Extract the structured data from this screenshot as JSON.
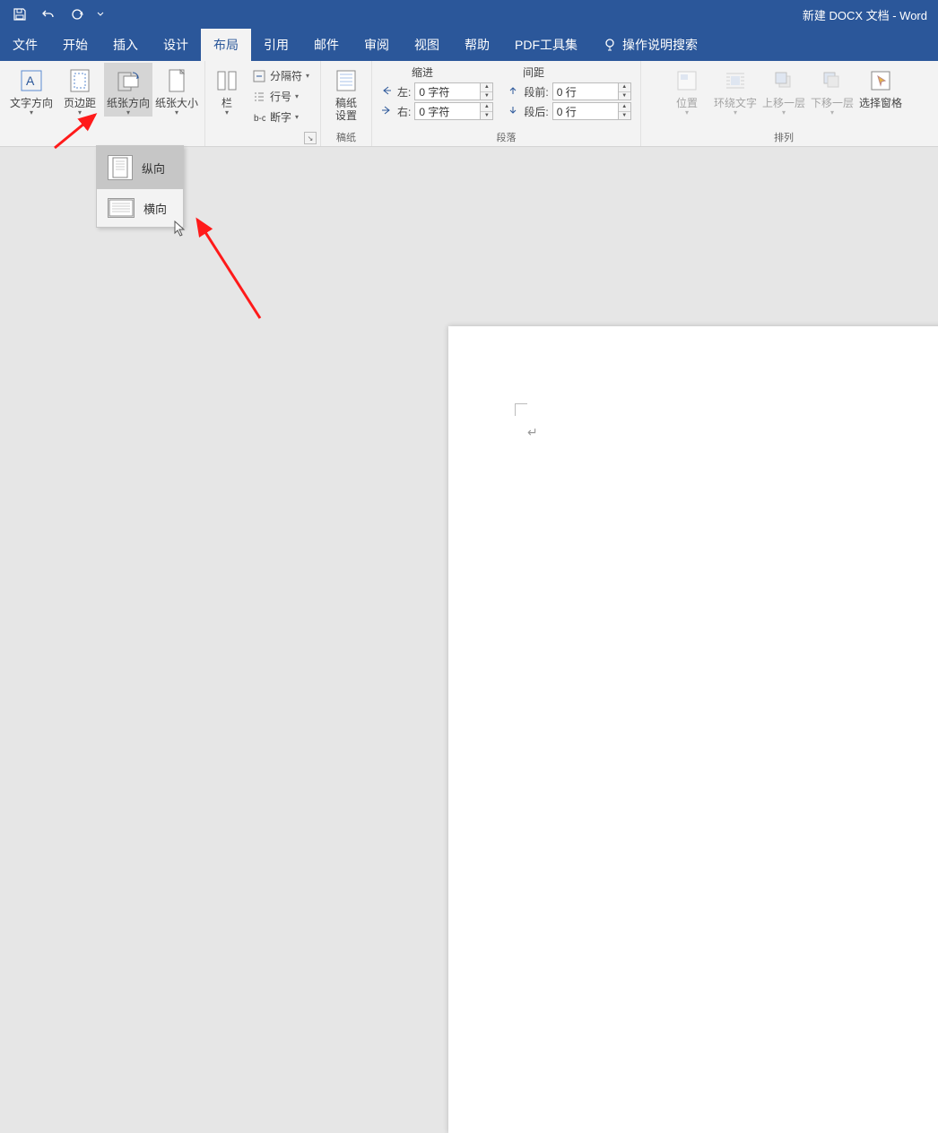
{
  "titlebar": {
    "title": "新建 DOCX 文档 - Word"
  },
  "tabs": {
    "file": "文件",
    "home": "开始",
    "insert": "插入",
    "design": "设计",
    "layout": "布局",
    "references": "引用",
    "mailings": "邮件",
    "review": "审阅",
    "view": "视图",
    "help": "帮助",
    "pdf": "PDF工具集",
    "tellme": "操作说明搜索"
  },
  "ribbon": {
    "page_setup": {
      "text_direction": "文字方向",
      "margins": "页边距",
      "orientation": "纸张方向",
      "size": "纸张大小",
      "columns": "栏",
      "breaks": "分隔符",
      "line_numbers": "行号",
      "hyphenation": "断字"
    },
    "manuscript": {
      "button": "稿纸\n设置",
      "label": "稿纸"
    },
    "paragraph": {
      "header_indent": "缩进",
      "header_spacing": "间距",
      "left_label": "左:",
      "right_label": "右:",
      "before_label": "段前:",
      "after_label": "段后:",
      "left_value": "0 字符",
      "right_value": "0 字符",
      "before_value": "0 行",
      "after_value": "0 行",
      "label": "段落"
    },
    "arrange": {
      "position": "位置",
      "wrap": "环绕文字",
      "forward": "上移一层",
      "backward": "下移一层",
      "selection_pane": "选择窗格",
      "label": "排列"
    }
  },
  "dropdown": {
    "portrait": "纵向",
    "landscape": "横向"
  }
}
